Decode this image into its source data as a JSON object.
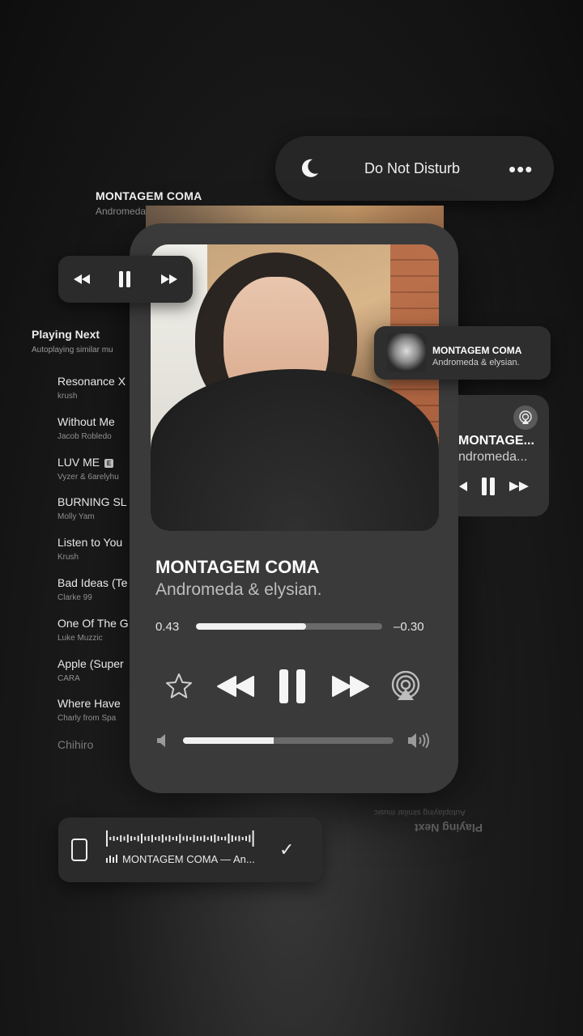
{
  "dnd": {
    "label": "Do Not Disturb",
    "more": "•••"
  },
  "top": {
    "title": "MONTAGEM COMA",
    "artist": "Andromeda"
  },
  "now_playing": {
    "title": "MONTAGEM COMA",
    "artist": "Andromeda & elysian.",
    "elapsed": "0.43",
    "remaining": "–0.30",
    "progress": 0.59,
    "volume": 0.43
  },
  "playing_next": {
    "title": "Playing Next",
    "subtitle": "Autoplaying similar mu",
    "items": [
      {
        "name": "Resonance X",
        "artist": "krush"
      },
      {
        "name": "Without Me",
        "artist": "Jacob Robledo"
      },
      {
        "name": "LUV ME",
        "artist": "Vyzer & 6arelyhu",
        "explicit": "E"
      },
      {
        "name": "BURNING SL",
        "artist": "Molly Yam"
      },
      {
        "name": "Listen to You",
        "artist": "Krush"
      },
      {
        "name": "Bad Ideas (Te",
        "artist": "Clarke 99"
      },
      {
        "name": "One Of The G",
        "artist": "Luke Muzzic"
      },
      {
        "name": "Apple (Super",
        "artist": "CARA"
      },
      {
        "name": "Where Have",
        "artist": "Charly from Spa"
      }
    ],
    "last": "Chihiro"
  },
  "notification": {
    "title": "MONTAGEM COMA",
    "artist": "Andromeda & elysian."
  },
  "side_widget": {
    "title": "MONTAGE...",
    "artist": "ndromeda..."
  },
  "device": {
    "label": "MONTAGEM COMA — An..."
  },
  "ghost": {
    "title": "Playing Next",
    "subtitle": "Autoplaying similar music"
  },
  "colors": {
    "background": "#1c1c1c",
    "card": "#3a3a3a",
    "accent": "#f1f1f1"
  }
}
